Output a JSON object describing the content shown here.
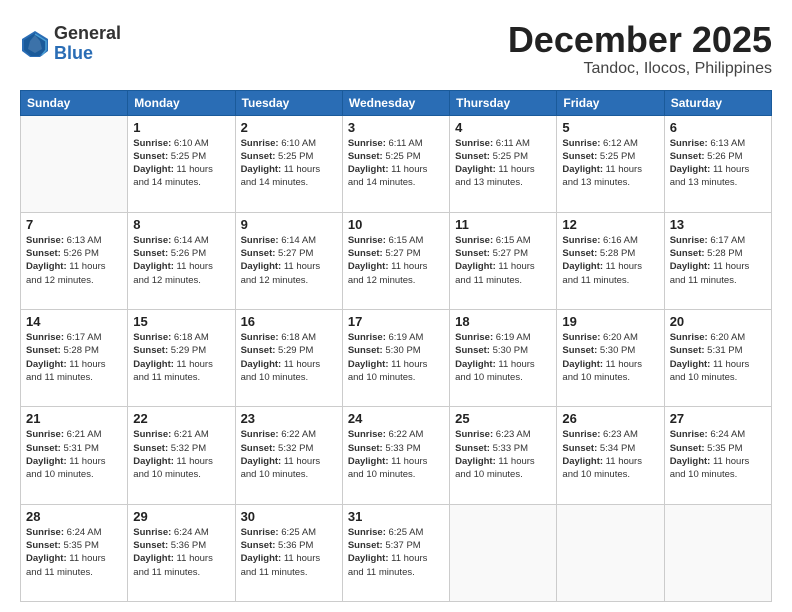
{
  "header": {
    "logo_general": "General",
    "logo_blue": "Blue",
    "title": "December 2025",
    "subtitle": "Tandoc, Ilocos, Philippines"
  },
  "days_of_week": [
    "Sunday",
    "Monday",
    "Tuesday",
    "Wednesday",
    "Thursday",
    "Friday",
    "Saturday"
  ],
  "weeks": [
    [
      {
        "day": "",
        "sunrise": "",
        "sunset": "",
        "daylight": ""
      },
      {
        "day": "1",
        "sunrise": "6:10 AM",
        "sunset": "5:25 PM",
        "daylight": "11 hours and 14 minutes."
      },
      {
        "day": "2",
        "sunrise": "6:10 AM",
        "sunset": "5:25 PM",
        "daylight": "11 hours and 14 minutes."
      },
      {
        "day": "3",
        "sunrise": "6:11 AM",
        "sunset": "5:25 PM",
        "daylight": "11 hours and 14 minutes."
      },
      {
        "day": "4",
        "sunrise": "6:11 AM",
        "sunset": "5:25 PM",
        "daylight": "11 hours and 13 minutes."
      },
      {
        "day": "5",
        "sunrise": "6:12 AM",
        "sunset": "5:25 PM",
        "daylight": "11 hours and 13 minutes."
      },
      {
        "day": "6",
        "sunrise": "6:13 AM",
        "sunset": "5:26 PM",
        "daylight": "11 hours and 13 minutes."
      }
    ],
    [
      {
        "day": "7",
        "sunrise": "6:13 AM",
        "sunset": "5:26 PM",
        "daylight": "11 hours and 12 minutes."
      },
      {
        "day": "8",
        "sunrise": "6:14 AM",
        "sunset": "5:26 PM",
        "daylight": "11 hours and 12 minutes."
      },
      {
        "day": "9",
        "sunrise": "6:14 AM",
        "sunset": "5:27 PM",
        "daylight": "11 hours and 12 minutes."
      },
      {
        "day": "10",
        "sunrise": "6:15 AM",
        "sunset": "5:27 PM",
        "daylight": "11 hours and 12 minutes."
      },
      {
        "day": "11",
        "sunrise": "6:15 AM",
        "sunset": "5:27 PM",
        "daylight": "11 hours and 11 minutes."
      },
      {
        "day": "12",
        "sunrise": "6:16 AM",
        "sunset": "5:28 PM",
        "daylight": "11 hours and 11 minutes."
      },
      {
        "day": "13",
        "sunrise": "6:17 AM",
        "sunset": "5:28 PM",
        "daylight": "11 hours and 11 minutes."
      }
    ],
    [
      {
        "day": "14",
        "sunrise": "6:17 AM",
        "sunset": "5:28 PM",
        "daylight": "11 hours and 11 minutes."
      },
      {
        "day": "15",
        "sunrise": "6:18 AM",
        "sunset": "5:29 PM",
        "daylight": "11 hours and 11 minutes."
      },
      {
        "day": "16",
        "sunrise": "6:18 AM",
        "sunset": "5:29 PM",
        "daylight": "11 hours and 10 minutes."
      },
      {
        "day": "17",
        "sunrise": "6:19 AM",
        "sunset": "5:30 PM",
        "daylight": "11 hours and 10 minutes."
      },
      {
        "day": "18",
        "sunrise": "6:19 AM",
        "sunset": "5:30 PM",
        "daylight": "11 hours and 10 minutes."
      },
      {
        "day": "19",
        "sunrise": "6:20 AM",
        "sunset": "5:30 PM",
        "daylight": "11 hours and 10 minutes."
      },
      {
        "day": "20",
        "sunrise": "6:20 AM",
        "sunset": "5:31 PM",
        "daylight": "11 hours and 10 minutes."
      }
    ],
    [
      {
        "day": "21",
        "sunrise": "6:21 AM",
        "sunset": "5:31 PM",
        "daylight": "11 hours and 10 minutes."
      },
      {
        "day": "22",
        "sunrise": "6:21 AM",
        "sunset": "5:32 PM",
        "daylight": "11 hours and 10 minutes."
      },
      {
        "day": "23",
        "sunrise": "6:22 AM",
        "sunset": "5:32 PM",
        "daylight": "11 hours and 10 minutes."
      },
      {
        "day": "24",
        "sunrise": "6:22 AM",
        "sunset": "5:33 PM",
        "daylight": "11 hours and 10 minutes."
      },
      {
        "day": "25",
        "sunrise": "6:23 AM",
        "sunset": "5:33 PM",
        "daylight": "11 hours and 10 minutes."
      },
      {
        "day": "26",
        "sunrise": "6:23 AM",
        "sunset": "5:34 PM",
        "daylight": "11 hours and 10 minutes."
      },
      {
        "day": "27",
        "sunrise": "6:24 AM",
        "sunset": "5:35 PM",
        "daylight": "11 hours and 10 minutes."
      }
    ],
    [
      {
        "day": "28",
        "sunrise": "6:24 AM",
        "sunset": "5:35 PM",
        "daylight": "11 hours and 11 minutes."
      },
      {
        "day": "29",
        "sunrise": "6:24 AM",
        "sunset": "5:36 PM",
        "daylight": "11 hours and 11 minutes."
      },
      {
        "day": "30",
        "sunrise": "6:25 AM",
        "sunset": "5:36 PM",
        "daylight": "11 hours and 11 minutes."
      },
      {
        "day": "31",
        "sunrise": "6:25 AM",
        "sunset": "5:37 PM",
        "daylight": "11 hours and 11 minutes."
      },
      {
        "day": "",
        "sunrise": "",
        "sunset": "",
        "daylight": ""
      },
      {
        "day": "",
        "sunrise": "",
        "sunset": "",
        "daylight": ""
      },
      {
        "day": "",
        "sunrise": "",
        "sunset": "",
        "daylight": ""
      }
    ]
  ],
  "labels": {
    "sunrise": "Sunrise: ",
    "sunset": "Sunset: ",
    "daylight": "Daylight: "
  }
}
